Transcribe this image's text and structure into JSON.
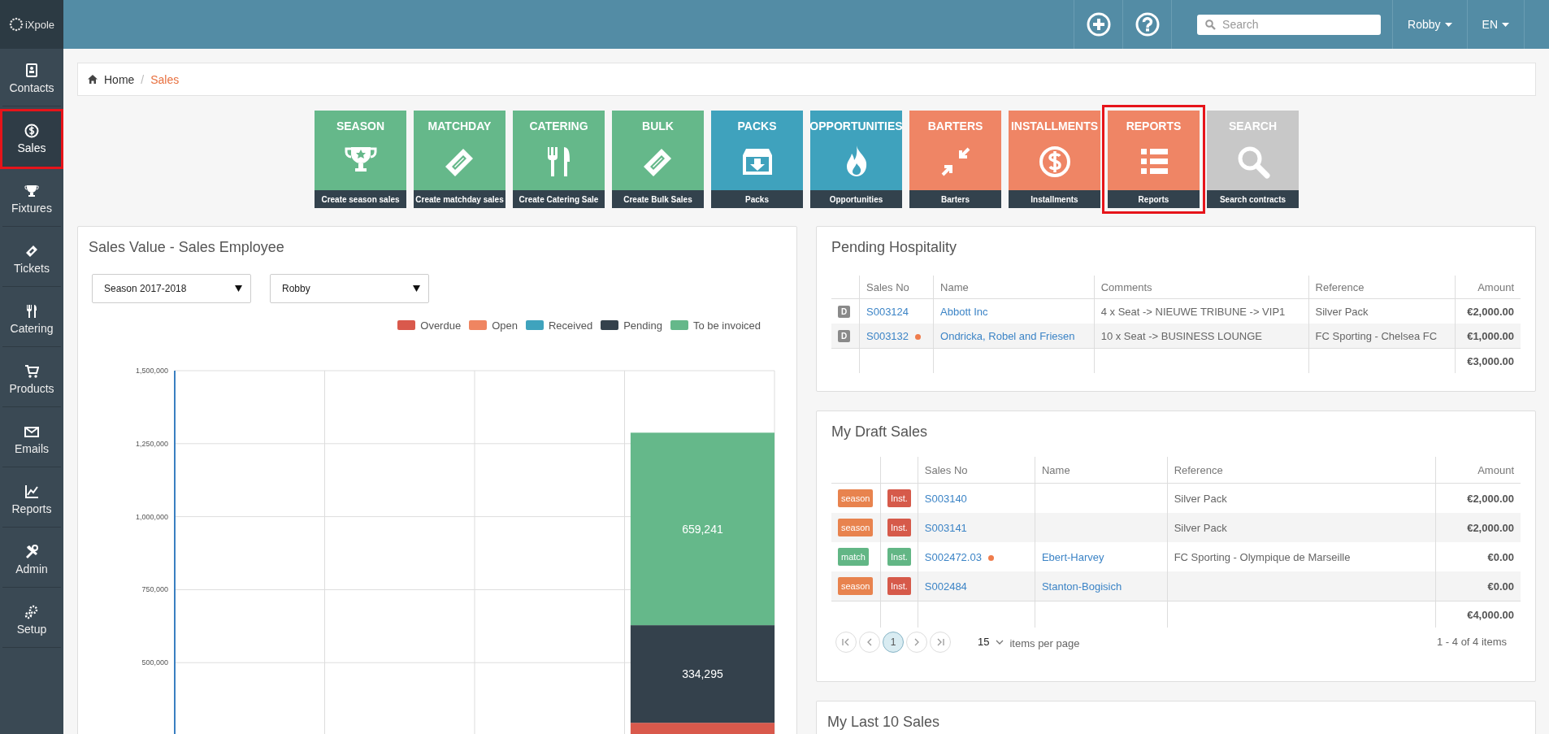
{
  "header": {
    "logo": "iXpole",
    "search": {
      "placeholder": "Search"
    },
    "user": "Robby",
    "language": "EN"
  },
  "sidebar": {
    "items": [
      {
        "label": "Contacts",
        "selected": false,
        "highlighted": false
      },
      {
        "label": "Sales",
        "selected": true,
        "highlighted": true
      },
      {
        "label": "Fixtures",
        "selected": false,
        "highlighted": false
      },
      {
        "label": "Tickets",
        "selected": false,
        "highlighted": false
      },
      {
        "label": "Catering",
        "selected": false,
        "highlighted": false
      },
      {
        "label": "Products",
        "selected": false,
        "highlighted": false
      },
      {
        "label": "Emails",
        "selected": false,
        "highlighted": false
      },
      {
        "label": "Reports",
        "selected": false,
        "highlighted": false
      },
      {
        "label": "Admin",
        "selected": false,
        "highlighted": false
      },
      {
        "label": "Setup",
        "selected": false,
        "highlighted": false
      }
    ]
  },
  "breadcrumb": {
    "items": [
      "Home",
      "Sales"
    ],
    "separator": "/"
  },
  "tiles": [
    {
      "title": "SEASON",
      "caption": "Create season sales",
      "color": "#65b88a",
      "highlighted": false
    },
    {
      "title": "MATCHDAY",
      "caption": "Create matchday sales",
      "color": "#65b88a",
      "highlighted": false
    },
    {
      "title": "CATERING",
      "caption": "Create Catering Sale",
      "color": "#65b88a",
      "highlighted": false
    },
    {
      "title": "BULK",
      "caption": "Create Bulk Sales",
      "color": "#65b88a",
      "highlighted": false
    },
    {
      "title": "PACKS",
      "caption": "Packs",
      "color": "#3fa2bd",
      "highlighted": false
    },
    {
      "title": "OPPORTUNITIES",
      "caption": "Opportunities",
      "color": "#3fa2bd",
      "highlighted": false
    },
    {
      "title": "BARTERS",
      "caption": "Barters",
      "color": "#ef8565",
      "highlighted": false
    },
    {
      "title": "INSTALLMENTS",
      "caption": "Installments",
      "color": "#ef8565",
      "highlighted": false
    },
    {
      "title": "REPORTS",
      "caption": "Reports",
      "color": "#ef8565",
      "highlighted": true
    },
    {
      "title": "SEARCH",
      "caption": "Search contracts",
      "color": "#c8c8c8",
      "highlighted": false
    }
  ],
  "sales_chart": {
    "title": "Sales Value - Sales Employee",
    "filters": [
      {
        "value": "Season 2017-2018"
      },
      {
        "value": "Robby"
      }
    ],
    "chart_data": {
      "type": "bar",
      "orientation": "vertical",
      "stacked": true,
      "grid": true,
      "ylim": [
        250000,
        1500000
      ],
      "value_labels": [
        [
          null,
          null,
          null,
          null
        ],
        [
          null,
          null,
          null,
          null
        ],
        [
          null,
          null,
          null,
          null
        ],
        [
          null,
          null,
          null,
          "334,295"
        ],
        [
          null,
          null,
          null,
          "659,241"
        ]
      ],
      "yticks": [
        {
          "value": 500000,
          "label": "500,000"
        },
        {
          "value": 750000,
          "label": "750,000"
        },
        {
          "value": 1000000,
          "label": "1,000,000"
        },
        {
          "value": 1250000,
          "label": "1,250,000"
        },
        {
          "value": 1500000,
          "label": "1,500,000"
        }
      ],
      "series": [
        {
          "name": "Overdue",
          "color": "#d9594c",
          "values": [
            null,
            null,
            null,
            294000
          ]
        },
        {
          "name": "Open",
          "color": "#ef8561",
          "values": [
            null,
            null,
            null,
            null
          ]
        },
        {
          "name": "Received",
          "color": "#3fa3bd",
          "values": [
            null,
            null,
            null,
            null
          ]
        },
        {
          "name": "Pending",
          "color": "#34414c",
          "values": [
            null,
            null,
            null,
            334295
          ]
        },
        {
          "name": "To be invoiced",
          "color": "#65b88a",
          "values": [
            null,
            null,
            null,
            659241
          ]
        }
      ]
    }
  },
  "pending_hospitality": {
    "title": "Pending Hospitality",
    "columns": [
      "Sales No",
      "Name",
      "Comments",
      "Reference",
      "Amount"
    ],
    "rows": [
      {
        "badge": "D",
        "sales_no": "S003124",
        "dot": false,
        "name": "Abbott Inc",
        "comments": "4 x Seat -> NIEUWE TRIBUNE -> VIP1",
        "reference": "Silver Pack",
        "amount": "€2,000.00"
      },
      {
        "badge": "D",
        "sales_no": "S003132",
        "dot": true,
        "name": "Ondricka, Robel and Friesen",
        "comments": "10 x Seat -> BUSINESS LOUNGE",
        "reference": "FC Sporting - Chelsea FC",
        "amount": "€1,000.00"
      }
    ],
    "total": "€3,000.00"
  },
  "draft_sales": {
    "title": "My Draft Sales",
    "columns": [
      "Sales No",
      "Name",
      "Reference",
      "Amount"
    ],
    "rows": [
      {
        "type": {
          "label": "season",
          "color": "#e8834e"
        },
        "payment": {
          "label": "Inst.",
          "color": "#d65a4a"
        },
        "sales_no": "S003140",
        "dot": false,
        "reference": "Silver Pack",
        "amount": "€2,000.00"
      },
      {
        "type": {
          "label": "season",
          "color": "#e8834e"
        },
        "payment": {
          "label": "Inst.",
          "color": "#d65a4a"
        },
        "sales_no": "S003141",
        "dot": false,
        "reference": "Silver Pack",
        "amount": "€2,000.00"
      },
      {
        "type": {
          "label": "match",
          "color": "#62b685"
        },
        "payment": {
          "label": "Inst.",
          "color": "#62b685"
        },
        "sales_no": "S002472.03",
        "dot": true,
        "name": "Ebert-Harvey",
        "reference": "FC Sporting - Olympique de Marseille",
        "amount": "€0.00"
      },
      {
        "type": {
          "label": "season",
          "color": "#e8834e"
        },
        "payment": {
          "label": "Inst.",
          "color": "#d65a4a"
        },
        "sales_no": "S002484",
        "dot": false,
        "name": "Stanton-Bogisich",
        "amount": "€0.00"
      }
    ],
    "total": "€4,000.00",
    "pagination": {
      "pages": [
        {
          "label": "1",
          "selected": true
        }
      ],
      "page_size": "15",
      "page_size_label": "items per page",
      "summary": "1 - 4 of 4 items"
    }
  },
  "last_sales": {
    "title": "My Last 10 Sales"
  }
}
